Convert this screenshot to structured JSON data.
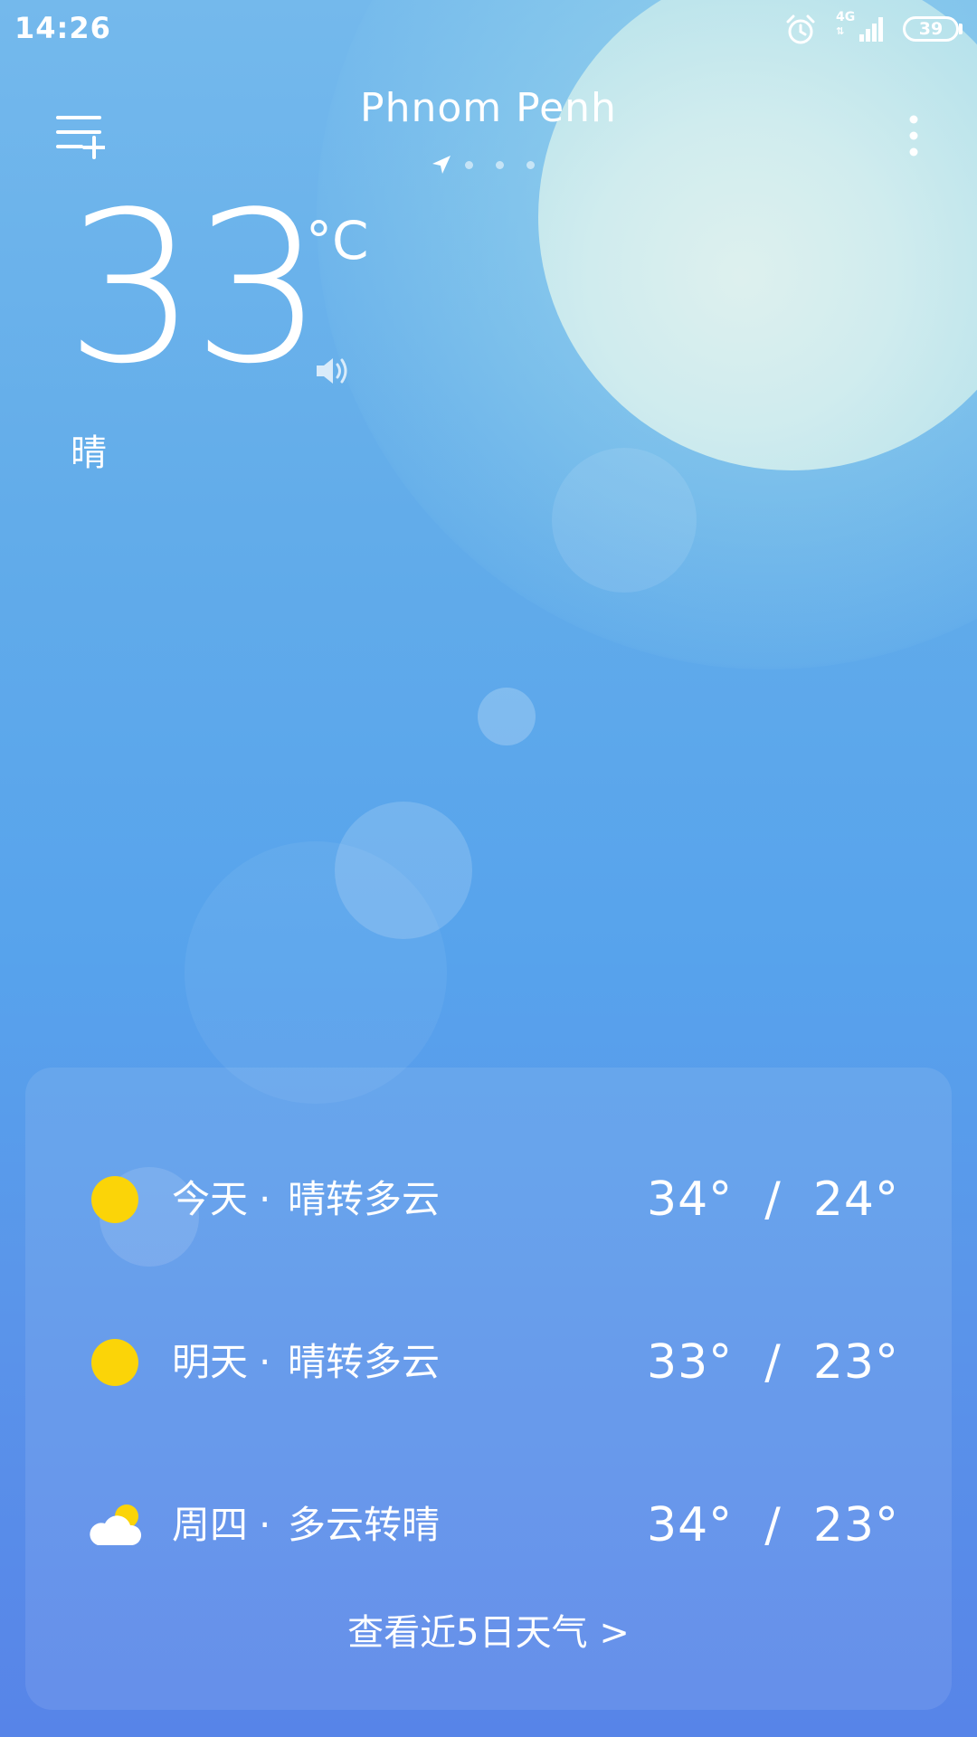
{
  "status_bar": {
    "time": "14:26",
    "network": "4G",
    "battery_level": "39"
  },
  "header": {
    "city": "Phnom Penh",
    "page_count": 4,
    "active_page": 0
  },
  "current": {
    "temperature": "33",
    "unit": "°C",
    "condition": "晴"
  },
  "forecast": {
    "rows": [
      {
        "day": "今天",
        "separator": "·",
        "description": "晴转多云",
        "high": "34°",
        "low": "24°",
        "icon": "sun-icon",
        "range": "34°  /  24°"
      },
      {
        "day": "明天",
        "separator": "·",
        "description": "晴转多云",
        "high": "33°",
        "low": "23°",
        "icon": "sun-icon",
        "range": "33°  /  23°"
      },
      {
        "day": "周四",
        "separator": "·",
        "description": "多云转晴",
        "high": "34°",
        "low": "23°",
        "icon": "partly-cloudy-icon",
        "range": "34°  /  23°"
      }
    ],
    "more_label": "查看近5日天气  >"
  },
  "colors": {
    "sun_yellow": "#fbd408",
    "background_top": "#74b9ec",
    "background_bottom": "#5784e8"
  }
}
